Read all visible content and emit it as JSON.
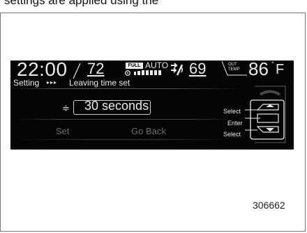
{
  "caption_partial": "settings are applied using the",
  "status_bar": {
    "time": "22:00",
    "left_temp": "72",
    "fan_mode_badge": "FULL",
    "fan_auto": "AUTO",
    "right_temp": "69",
    "out_label_line1": "OUT",
    "out_label_line2": "TEMP",
    "outside_temp": "86",
    "degree": "°",
    "unit": "F"
  },
  "breadcrumb": {
    "root": "Setting",
    "arrows": "▸▸▸",
    "current": "Leaving time set"
  },
  "setting": {
    "updown_glyph": "≑",
    "value": "30 seconds"
  },
  "buttons": {
    "set": "Set",
    "go_back": "Go Back"
  },
  "controller_labels": {
    "select_top": "Select",
    "enter": "Enter",
    "select_bottom": "Select"
  },
  "figure_code": "306662"
}
